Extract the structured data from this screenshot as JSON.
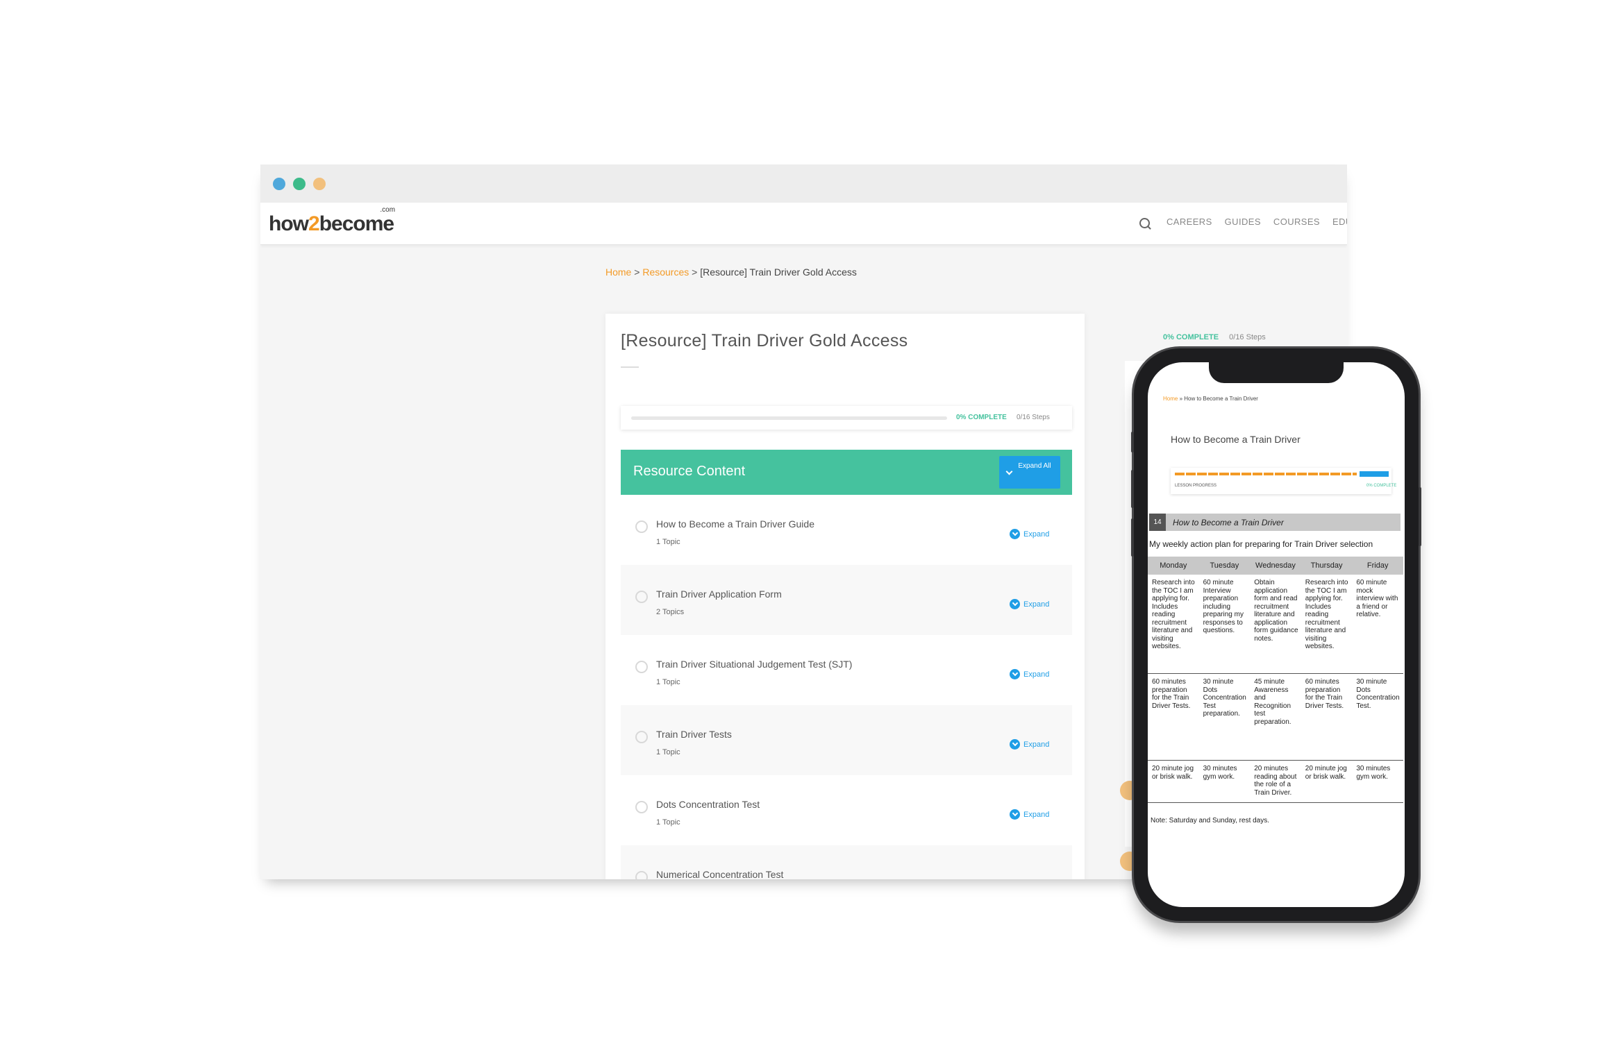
{
  "site": {
    "logo_prefix": "how",
    "logo_two": "2",
    "logo_suffix": "become",
    "logo_com": ".com"
  },
  "icons": {
    "search": "search-icon",
    "expand": "chevron-down-circle-icon",
    "expand_all": "chevron-down-icon"
  },
  "colors": {
    "accent_green": "#45c29e",
    "accent_orange": "#f39a26",
    "accent_blue": "#1f9ee6"
  },
  "nav": [
    "CAREERS",
    "GUIDES",
    "COURSES",
    "EDUCAT"
  ],
  "breadcrumb": {
    "home": "Home",
    "sep": ">",
    "resources": "Resources",
    "current": "[Resource] Train Driver Gold Access"
  },
  "page": {
    "title": "[Resource] Train Driver Gold Access",
    "progress": {
      "percent": 0,
      "percent_label": "0% COMPLETE",
      "steps": "0/16 Steps"
    },
    "content_header": "Resource Content",
    "expand_all_label": "Expand All",
    "expand_label": "Expand",
    "lessons": [
      {
        "title": "How to Become a Train Driver Guide",
        "topics": "1 Topic"
      },
      {
        "title": "Train Driver Application Form",
        "topics": "2 Topics"
      },
      {
        "title": "Train Driver Situational Judgement Test (SJT)",
        "topics": "1 Topic"
      },
      {
        "title": "Train Driver Tests",
        "topics": "1 Topic"
      },
      {
        "title": "Dots Concentration Test",
        "topics": "1 Topic"
      },
      {
        "title": "Numerical Concentration Test",
        "topics": ""
      }
    ]
  },
  "sidebar": {
    "percent_label": "0% COMPLETE",
    "steps": "0/16 Steps"
  },
  "phone": {
    "breadcrumb_home": "Home",
    "breadcrumb_rest": "» How to Become a Train Driver",
    "title": "How to Become a Train Driver",
    "lesson_progress_label": "LESSON PROGRESS",
    "lesson_progress_pct": "0% COMPLETE",
    "section_number": "14",
    "section_title": "How to Become a Train Driver",
    "intro": "My weekly action plan for preparing for Train Driver selection",
    "table": {
      "headers": [
        "Monday",
        "Tuesday",
        "Wednesday",
        "Thursday",
        "Friday"
      ],
      "rows": [
        [
          "Research into the TOC I am applying for. Includes reading recruitment literature and visiting websites.",
          "60 minute Interview preparation including preparing my responses to questions.",
          "Obtain application form and read recruitment literature and application form guidance notes.",
          "Research into the TOC I am applying for. Includes reading recruitment literature and visiting websites.",
          "60 minute mock interview with a friend or relative."
        ],
        [
          "60 minutes preparation for the Train Driver Tests.",
          "30 minute Dots Concentration Test preparation.",
          "45 minute Awareness and Recognition test preparation.",
          "60 minutes preparation for the Train Driver Tests.",
          "30 minute Dots Concentration Test."
        ],
        [
          "20 minute jog or brisk walk.",
          "30 minutes gym work.",
          "20 minutes reading about the role of a Train Driver.",
          "20 minute jog or brisk walk.",
          "30 minutes gym work."
        ]
      ]
    },
    "note": "Note: Saturday and Sunday, rest days."
  }
}
